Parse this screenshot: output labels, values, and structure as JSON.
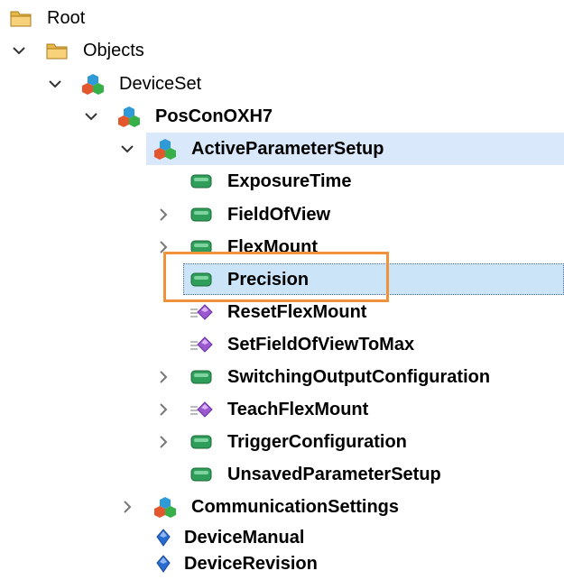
{
  "tree": {
    "nodes": [
      {
        "label": "Root",
        "icon": "folder-icon",
        "expander": "none",
        "bold": false
      },
      {
        "label": "Objects",
        "icon": "folder-icon",
        "expander": "expanded",
        "bold": false
      },
      {
        "label": "DeviceSet",
        "icon": "object-cubes-icon",
        "expander": "expanded",
        "bold": false
      },
      {
        "label": "PosConOXH7",
        "icon": "object-cubes-icon",
        "expander": "expanded",
        "bold": true
      },
      {
        "label": "ActiveParameterSetup",
        "icon": "object-cubes-icon",
        "expander": "expanded",
        "bold": true
      },
      {
        "label": "ExposureTime",
        "icon": "variable-tag-icon",
        "expander": "none",
        "bold": true
      },
      {
        "label": "FieldOfView",
        "icon": "variable-tag-icon",
        "expander": "collapsed",
        "bold": true
      },
      {
        "label": "FlexMount",
        "icon": "variable-tag-icon",
        "expander": "collapsed",
        "bold": true
      },
      {
        "label": "Precision",
        "icon": "variable-tag-icon",
        "expander": "none",
        "bold": true
      },
      {
        "label": "ResetFlexMount",
        "icon": "method-icon",
        "expander": "none",
        "bold": true
      },
      {
        "label": "SetFieldOfViewToMax",
        "icon": "method-icon",
        "expander": "none",
        "bold": true
      },
      {
        "label": "SwitchingOutputConfiguration",
        "icon": "variable-tag-icon",
        "expander": "collapsed",
        "bold": true
      },
      {
        "label": "TeachFlexMount",
        "icon": "method-icon",
        "expander": "collapsed",
        "bold": true
      },
      {
        "label": "TriggerConfiguration",
        "icon": "variable-tag-icon",
        "expander": "collapsed",
        "bold": true
      },
      {
        "label": "UnsavedParameterSetup",
        "icon": "variable-tag-icon",
        "expander": "none",
        "bold": true
      },
      {
        "label": "CommunicationSettings",
        "icon": "object-cubes-icon",
        "expander": "collapsed",
        "bold": true
      },
      {
        "label": "DeviceManual",
        "icon": "property-diamond-icon",
        "expander": "none",
        "bold": true
      },
      {
        "label": "DeviceRevision",
        "icon": "property-diamond-icon",
        "expander": "none",
        "bold": true
      }
    ],
    "selected_label": "Precision",
    "colors": {
      "selection": "#cce4f7",
      "hover": "#d9e8fb",
      "focus_outline": "#f0923b",
      "folder": "#e8b84a",
      "variable": "#2f9e5a",
      "method": "#9b59d0",
      "property": "#2a6bd1"
    }
  }
}
